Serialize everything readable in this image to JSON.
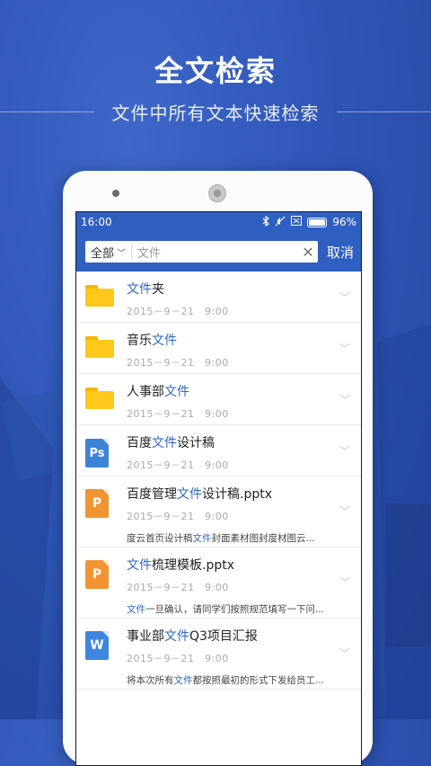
{
  "hero": {
    "title": "全文检索",
    "subtitle": "文件中所有文本快速检索"
  },
  "statusbar": {
    "time": "16:00",
    "battery": "96%"
  },
  "search": {
    "scope": "全部",
    "query": "文件",
    "cancel": "取消"
  },
  "results": [
    {
      "icon": "folder-icon",
      "pre": "",
      "hl": "文件",
      "post": "夹",
      "date": "2015－9－21　9:00"
    },
    {
      "icon": "folder-icon",
      "pre": "音乐",
      "hl": "文件",
      "post": "",
      "date": "2015－9－21　9:00"
    },
    {
      "icon": "folder-icon",
      "pre": "人事部",
      "hl": "文件",
      "post": "",
      "date": "2015－9－21　9:00"
    },
    {
      "icon": "ps-file-icon",
      "pre": "百度",
      "hl": "文件",
      "post": "设计稿",
      "date": "2015－9－21　9:00"
    },
    {
      "icon": "ppt-file-icon",
      "pre": "百度管理",
      "hl": "文件",
      "post": "设计稿.pptx",
      "date": "2015－9－21　9:00",
      "snippet_pre": "度云首页设计稿",
      "snippet_hl": "文件",
      "snippet_post": "封面素材图封度材图云..."
    },
    {
      "icon": "ppt-file-icon",
      "pre": "",
      "hl": "文件",
      "post": "梳理模板.pptx",
      "date": "2015－9－21　9:00",
      "snippet_pre": "",
      "snippet_hl": "文件",
      "snippet_post": "一旦确认，请同学们按照规范填写一下问..."
    },
    {
      "icon": "word-file-icon",
      "pre": "事业部",
      "hl": "文件",
      "post": "Q3项目汇报",
      "date": "2015－9－21　9:00",
      "snippet_pre": "将本次所有",
      "snippet_hl": "文件",
      "snippet_post": "都按照最初的形式下发给员工..."
    }
  ],
  "icon_labels": {
    "ps": "Ps",
    "p": "P",
    "w": "W"
  },
  "colors": {
    "brand": "#2f5fc0",
    "highlight": "#2f66c8",
    "folder": "#ffc81a",
    "ppt": "#f29432",
    "word": "#3f86e0"
  }
}
